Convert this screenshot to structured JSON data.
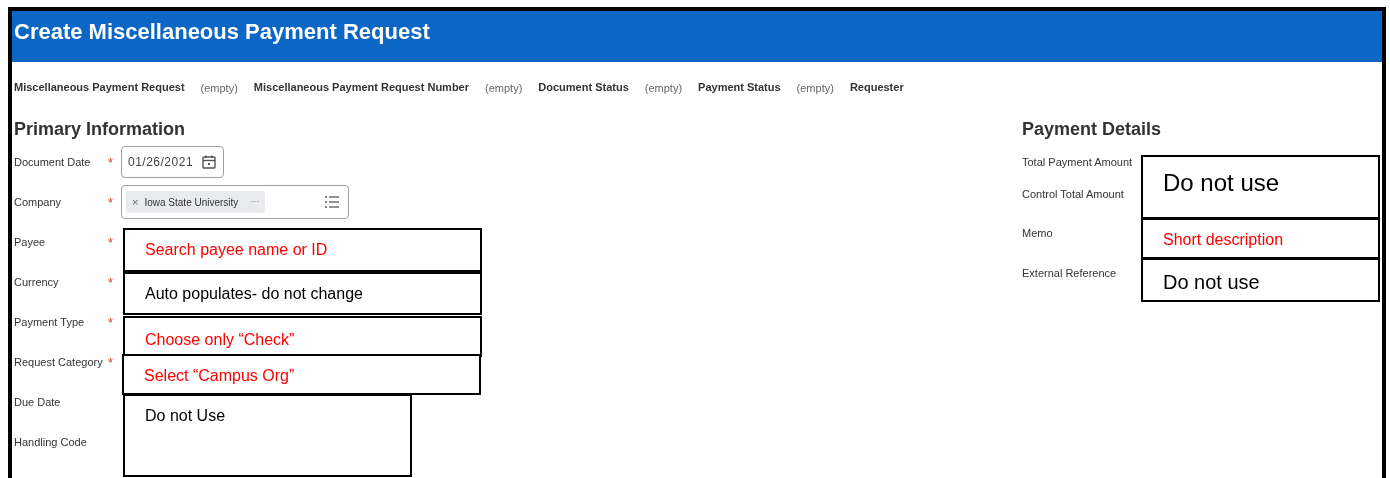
{
  "window": {
    "title": "Create Miscellaneous Payment Request"
  },
  "summary_fields": [
    {
      "label": "Miscellaneous Payment Request",
      "value": "(empty)"
    },
    {
      "label": "Miscellaneous Payment Request Number",
      "value": "(empty)"
    },
    {
      "label": "Document Status",
      "value": "(empty)"
    },
    {
      "label": "Payment Status",
      "value": "(empty)"
    },
    {
      "label": "Requester"
    }
  ],
  "primary_information": {
    "title": "Primary Information",
    "fields": [
      {
        "label": "Document Date",
        "required_mark": "*",
        "kind": "date",
        "value": "01/26/2021"
      },
      {
        "label": "Company",
        "required_mark": "*",
        "kind": "multiselect",
        "value": "Iowa State University",
        "chip_remove": "×",
        "chip_more": "···"
      },
      {
        "label": "Payee",
        "required_mark": "*",
        "kind": "hidden"
      },
      {
        "label": "Currency",
        "required_mark": "*",
        "kind": "hidden"
      },
      {
        "label": "Payment Type",
        "required_mark": "*",
        "kind": "hidden"
      },
      {
        "label": "Request Category",
        "required_mark": "*",
        "kind": "hidden"
      },
      {
        "label": "Due Date",
        "kind": "hidden"
      },
      {
        "label": "Handling Code",
        "kind": "hidden"
      }
    ]
  },
  "payment_details": {
    "title": "Payment Details",
    "fields": [
      {
        "label": "Total Payment Amount"
      },
      {
        "label": "Control Total Amount"
      },
      {
        "label": "Memo"
      },
      {
        "label": "External Reference"
      }
    ]
  },
  "annotations": [
    {
      "text": "Search payee name or ID",
      "color": "#ff0000"
    },
    {
      "text": "Auto populates- do not change",
      "color": "#000000"
    },
    {
      "text": "Choose only “Check”",
      "color": "#ff0000"
    },
    {
      "text": "Select “Campus Org”",
      "color": "#ff0000"
    },
    {
      "text": "Do not Use",
      "color": "#000000"
    },
    {
      "text": "Do not use",
      "color": "#000000"
    },
    {
      "text": "Short description",
      "color": "#ff0000"
    },
    {
      "text": "Do not use",
      "color": "#000000"
    }
  ]
}
